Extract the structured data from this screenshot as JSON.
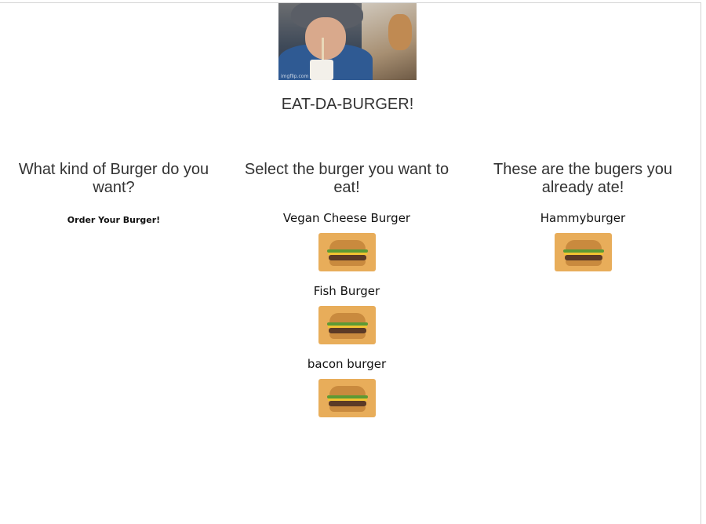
{
  "header": {
    "hero_image_icon": "boy-eating-burger-gif",
    "hero_watermark": "imgflip.com",
    "title": "EAT-DA-BURGER!"
  },
  "order_column": {
    "heading": "What kind of Burger do you want?",
    "order_link": "Order Your Burger!"
  },
  "to_eat_column": {
    "heading": "Select the burger you want to eat!",
    "burgers": [
      {
        "name": "Vegan Cheese Burger",
        "icon": "burger-icon"
      },
      {
        "name": "Fish Burger",
        "icon": "burger-icon"
      },
      {
        "name": "bacon burger",
        "icon": "burger-icon"
      }
    ]
  },
  "eaten_column": {
    "heading": "These are the bugers you already ate!",
    "burgers": [
      {
        "name": "Hammyburger",
        "icon": "burger-icon"
      }
    ]
  },
  "colors": {
    "button_background": "#e8ad5a",
    "text": "#333333"
  }
}
